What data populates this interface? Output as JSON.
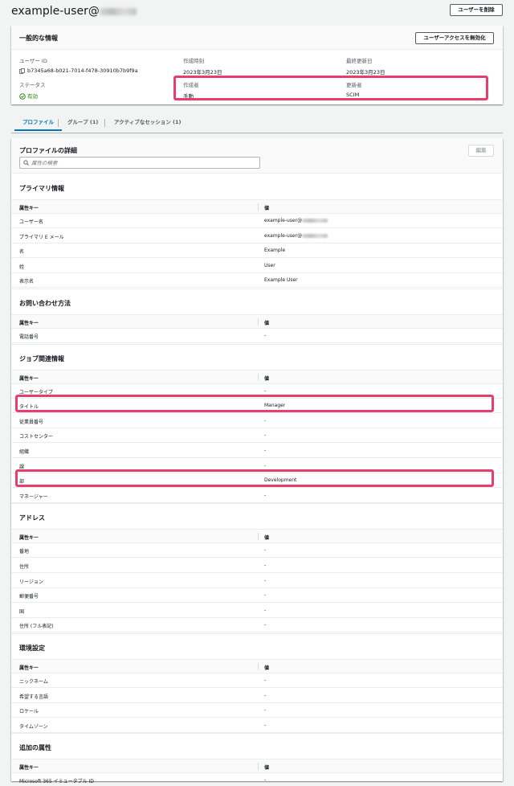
{
  "header": {
    "title": "example-user@",
    "delete_button": "ユーザーを削除"
  },
  "general": {
    "title": "一般的な情報",
    "disable_button": "ユーザーアクセスを無効化",
    "user_id_label": "ユーザー ID",
    "user_id": "b7345a68-b021-7014-f478-30910b7b9f9a",
    "status_label": "ステータス",
    "status": "有効",
    "created_at_label": "作成時刻",
    "created_at": "2023年3月23日",
    "updated_at_label": "最終更新日",
    "updated_at": "2023年3月23日",
    "created_by_label": "作成者",
    "created_by": "手動",
    "updated_by_label": "更新者",
    "updated_by": "SCIM"
  },
  "tabs": [
    {
      "label": "プロファイル"
    },
    {
      "label": "グループ (1)"
    },
    {
      "label": "アクティブなセッション (1)"
    }
  ],
  "profile": {
    "title": "プロファイルの詳細",
    "edit_button": "編集",
    "search_placeholder": "属性の検索",
    "col_key": "属性キー",
    "col_value": "値"
  },
  "sections": [
    {
      "title": "プライマリ情報",
      "rows": [
        {
          "key": "ユーザー名",
          "value": "example-user@"
        },
        {
          "key": "プライマリ E メール",
          "value": "example-user@"
        },
        {
          "key": "名",
          "value": "Example"
        },
        {
          "key": "姓",
          "value": "User"
        },
        {
          "key": "表示名",
          "value": "Example User"
        }
      ]
    },
    {
      "title": "お問い合わせ方法",
      "rows": [
        {
          "key": "電話番号",
          "value": "-"
        }
      ]
    },
    {
      "title": "ジョブ関連情報",
      "rows": [
        {
          "key": "ユーザータイプ",
          "value": "-"
        },
        {
          "key": "タイトル",
          "value": "Manager"
        },
        {
          "key": "従業員番号",
          "value": "-"
        },
        {
          "key": "コストセンター",
          "value": "-"
        },
        {
          "key": "組織",
          "value": "-"
        },
        {
          "key": "課",
          "value": "-"
        },
        {
          "key": "部",
          "value": "Development"
        },
        {
          "key": "マネージャー",
          "value": "-"
        }
      ]
    },
    {
      "title": "アドレス",
      "rows": [
        {
          "key": "番地",
          "value": "-"
        },
        {
          "key": "住所",
          "value": "-"
        },
        {
          "key": "リージョン",
          "value": "-"
        },
        {
          "key": "郵便番号",
          "value": "-"
        },
        {
          "key": "国",
          "value": "-"
        },
        {
          "key": "住所 (フル表記)",
          "value": "-"
        }
      ]
    },
    {
      "title": "環境設定",
      "rows": [
        {
          "key": "ニックネーム",
          "value": "-"
        },
        {
          "key": "希望する言語",
          "value": "-"
        },
        {
          "key": "ロケール",
          "value": "-"
        },
        {
          "key": "タイムゾーン",
          "value": "-"
        }
      ]
    },
    {
      "title": "追加の属性",
      "rows": [
        {
          "key": "Microsoft 365 イミュータブル ID",
          "value": "-"
        }
      ]
    }
  ],
  "colors": {
    "accent": "#0073bb",
    "success": "#1d8102",
    "highlight": "#e83e6c"
  },
  "icons": {
    "copy": "copy-icon",
    "status": "check-circle-icon",
    "search": "search-icon"
  }
}
